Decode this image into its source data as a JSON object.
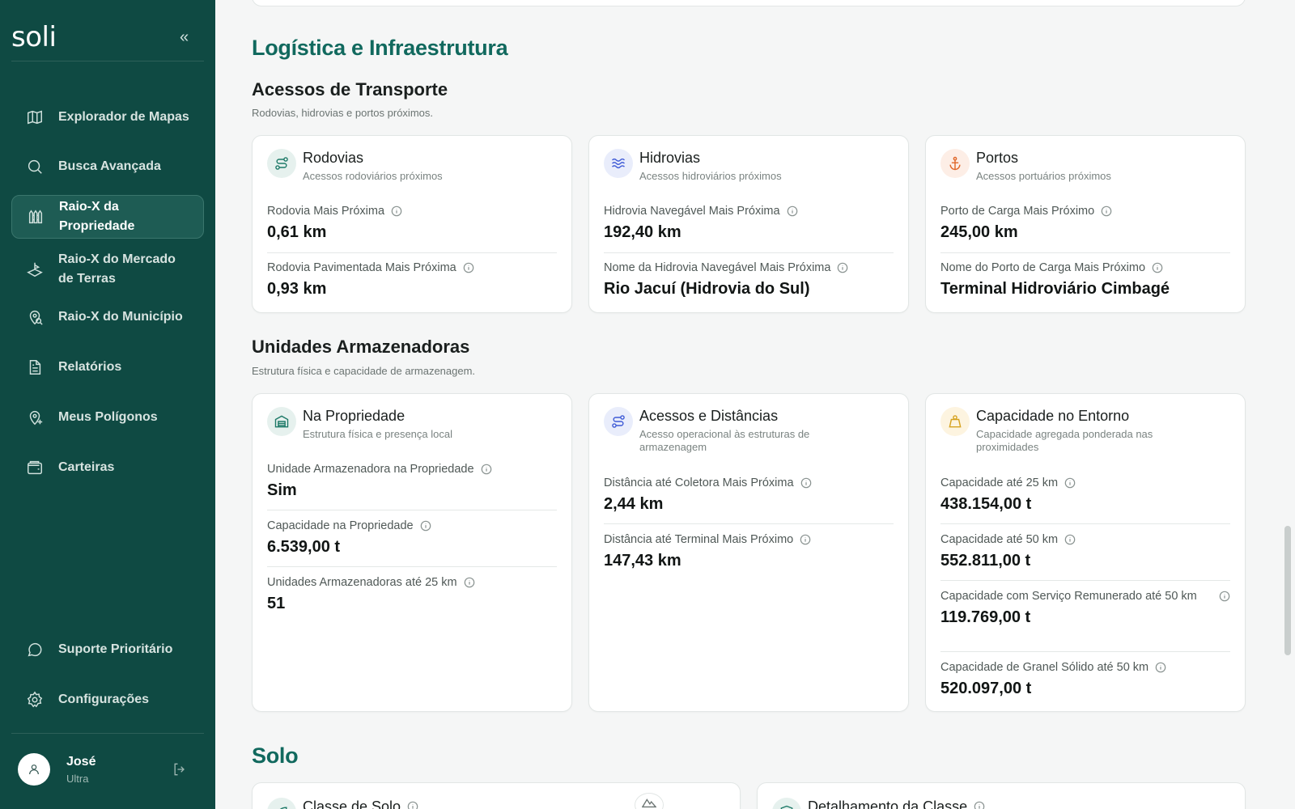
{
  "sidebar": {
    "logo": "soli",
    "collapse_icon": "chevrons-left-icon",
    "items": [
      {
        "label": "Explorador de Mapas",
        "icon": "map-icon"
      },
      {
        "label": "Busca Avançada",
        "icon": "search-icon"
      },
      {
        "label": "Raio-X da Propriedade",
        "icon": "fence-icon",
        "active": true
      },
      {
        "label": "Raio-X do Mercado de Terras",
        "icon": "landplot-icon"
      },
      {
        "label": "Raio-X do Município",
        "icon": "map-pin-search-icon"
      },
      {
        "label": "Relatórios",
        "icon": "document-icon"
      },
      {
        "label": "Meus Polígonos",
        "icon": "pin-plus-icon"
      },
      {
        "label": "Carteiras",
        "icon": "wallet-icon"
      },
      {
        "label": "Suporte Prioritário",
        "icon": "chat-icon"
      },
      {
        "label": "Configurações",
        "icon": "gear-icon"
      }
    ],
    "user": {
      "name": "José",
      "plan": "Ultra"
    }
  },
  "main": {
    "section_logistica": "Logística e Infraestrutura",
    "transporte": {
      "title": "Acessos de Transporte",
      "subtitle": "Rodovias, hidrovias e portos próximos.",
      "cards": [
        {
          "title": "Rodovias",
          "subtitle": "Acessos rodoviários próximos",
          "icon": "route-icon",
          "metrics": [
            {
              "label": "Rodovia Mais Próxima",
              "value": "0,61 km"
            },
            {
              "label": "Rodovia Pavimentada Mais Próxima",
              "value": "0,93 km"
            }
          ]
        },
        {
          "title": "Hidrovias",
          "subtitle": "Acessos hidroviários próximos",
          "icon": "waves-icon",
          "metrics": [
            {
              "label": "Hidrovia Navegável Mais Próxima",
              "value": "192,40 km"
            },
            {
              "label": "Nome da Hidrovia Navegável Mais Próxima",
              "value": "Rio Jacuí (Hidrovia do Sul)"
            }
          ]
        },
        {
          "title": "Portos",
          "subtitle": "Acessos portuários próximos",
          "icon": "anchor-icon",
          "metrics": [
            {
              "label": "Porto de Carga Mais Próximo",
              "value": "245,00 km"
            },
            {
              "label": "Nome do Porto de Carga Mais Próximo",
              "value": "Terminal Hidroviário Cimbagé"
            }
          ]
        }
      ]
    },
    "armazenadoras": {
      "title": "Unidades Armazenadoras",
      "subtitle": "Estrutura física e capacidade de armazenagem.",
      "cards": [
        {
          "title": "Na Propriedade",
          "subtitle": "Estrutura física e presença local",
          "icon": "warehouse-icon",
          "metrics": [
            {
              "label": "Unidade Armazenadora na Propriedade",
              "value": "Sim"
            },
            {
              "label": "Capacidade na Propriedade",
              "value": "6.539,00 t"
            },
            {
              "label": "Unidades Armazenadoras até 25 km",
              "value": "51"
            }
          ]
        },
        {
          "title": "Acessos e Distâncias",
          "subtitle": "Acesso operacional às estruturas de armazenagem",
          "icon": "route-icon",
          "metrics": [
            {
              "label": "Distância até Coletora Mais Próxima",
              "value": "2,44 km"
            },
            {
              "label": "Distância até Terminal Mais Próximo",
              "value": "147,43 km"
            }
          ]
        },
        {
          "title": "Capacidade no Entorno",
          "subtitle": "Capacidade agregada ponderada nas proximidades",
          "icon": "weight-icon",
          "metrics": [
            {
              "label": "Capacidade até 25 km",
              "value": "438.154,00 t"
            },
            {
              "label": "Capacidade até 50 km",
              "value": "552.811,00 t"
            },
            {
              "label": "Capacidade com Serviço Remunerado até 50 km",
              "value": "119.769,00 t"
            },
            {
              "label": "Capacidade de Granel Sólido até 50 km",
              "value": "520.097,00 t"
            }
          ]
        }
      ]
    },
    "section_solo": "Solo",
    "solo_cards": [
      {
        "title": "Classe de Solo",
        "icon": "leaf-icon"
      },
      {
        "title": "Detalhamento da Classe",
        "icon": "shield-icon"
      }
    ]
  }
}
